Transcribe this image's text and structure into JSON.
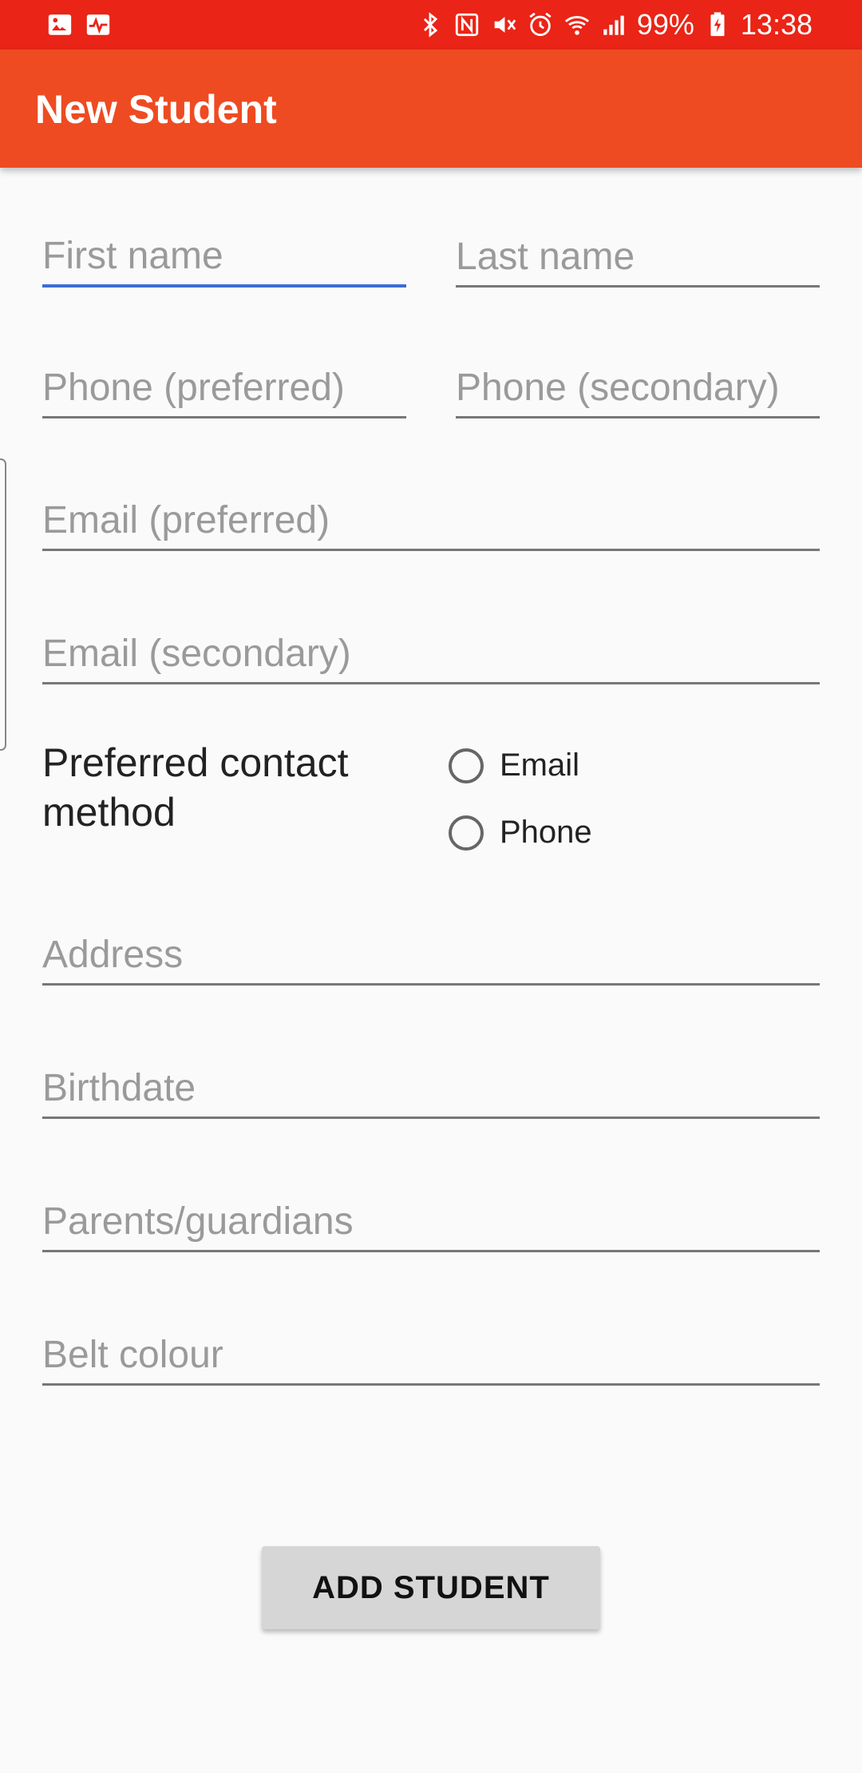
{
  "status_bar": {
    "battery": "99%",
    "time": "13:38",
    "left_icons": [
      "image-icon",
      "activity-icon"
    ],
    "right_icons": [
      "bluetooth-icon",
      "nfc-icon",
      "mute-icon",
      "alarm-icon",
      "wifi-icon",
      "signal-icon",
      "battery-charging-icon"
    ]
  },
  "app_bar": {
    "title": "New Student"
  },
  "form": {
    "first_name_placeholder": "First name",
    "last_name_placeholder": "Last name",
    "phone_preferred_placeholder": "Phone (preferred)",
    "phone_secondary_placeholder": "Phone (secondary)",
    "email_preferred_placeholder": "Email (preferred)",
    "email_secondary_placeholder": "Email (secondary)",
    "contact_method_label": "Preferred contact method",
    "contact_options": [
      "Email",
      "Phone"
    ],
    "address_placeholder": "Address",
    "birthdate_placeholder": "Birthdate",
    "parents_placeholder": "Parents/guardians",
    "belt_placeholder": "Belt colour"
  },
  "actions": {
    "add_student_label": "ADD STUDENT"
  },
  "colors": {
    "status_bar": "#ea2416",
    "app_bar": "#ee4b22",
    "focus_underline": "#3d6bd8",
    "background": "#fafafa",
    "button": "#d6d6d6"
  }
}
